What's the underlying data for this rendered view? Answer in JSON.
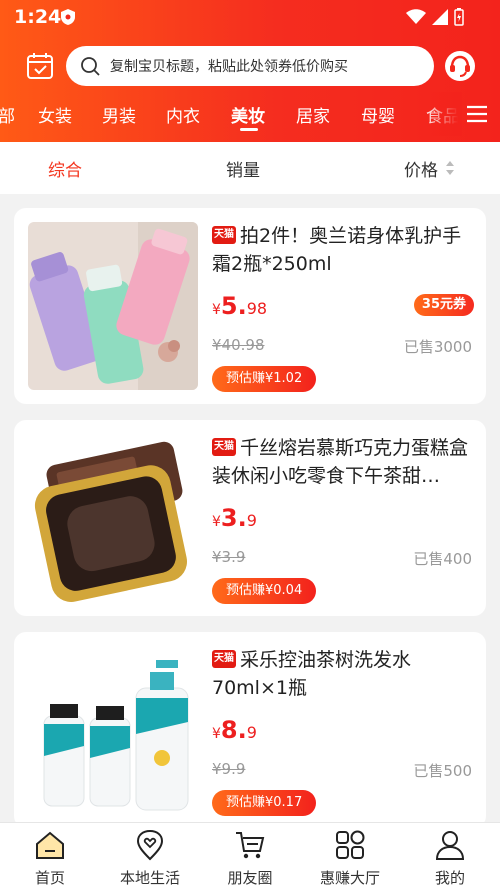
{
  "status": {
    "time": "1:24"
  },
  "search": {
    "placeholder": "复制宝贝标题，粘贴此处领券低价购买"
  },
  "categories": [
    "部",
    "女装",
    "男装",
    "内衣",
    "美妆",
    "居家",
    "母婴",
    "食品"
  ],
  "active_category": "美妆",
  "sort": {
    "comprehensive": "综合",
    "sales": "销量",
    "price": "价格"
  },
  "products": [
    {
      "badge": "天猫",
      "title": "拍2件！奥兰诺身体乳护手霜2瓶*250ml",
      "currency": "¥",
      "price_int": "5.",
      "price_dec": "98",
      "coupon": "35元券",
      "original_price": "¥40.98",
      "sold": "已售3000",
      "earn": "预估赚¥1.02"
    },
    {
      "badge": "天猫",
      "title": "千丝熔岩慕斯巧克力蛋糕盒装休闲小吃零食下午茶甜…",
      "currency": "¥",
      "price_int": "3.",
      "price_dec": "9",
      "coupon": "",
      "original_price": "¥3.9",
      "sold": "已售400",
      "earn": "预估赚¥0.04"
    },
    {
      "badge": "天猫",
      "title": "采乐控油茶树洗发水70ml×1瓶",
      "currency": "¥",
      "price_int": "8.",
      "price_dec": "9",
      "coupon": "",
      "original_price": "¥9.9",
      "sold": "已售500",
      "earn": "预估赚¥0.17"
    }
  ],
  "tabs": [
    "首页",
    "本地生活",
    "朋友圈",
    "惠赚大厅",
    "我的"
  ],
  "colors": {
    "brand": "#f52d1f",
    "price": "#ed1f1f"
  }
}
